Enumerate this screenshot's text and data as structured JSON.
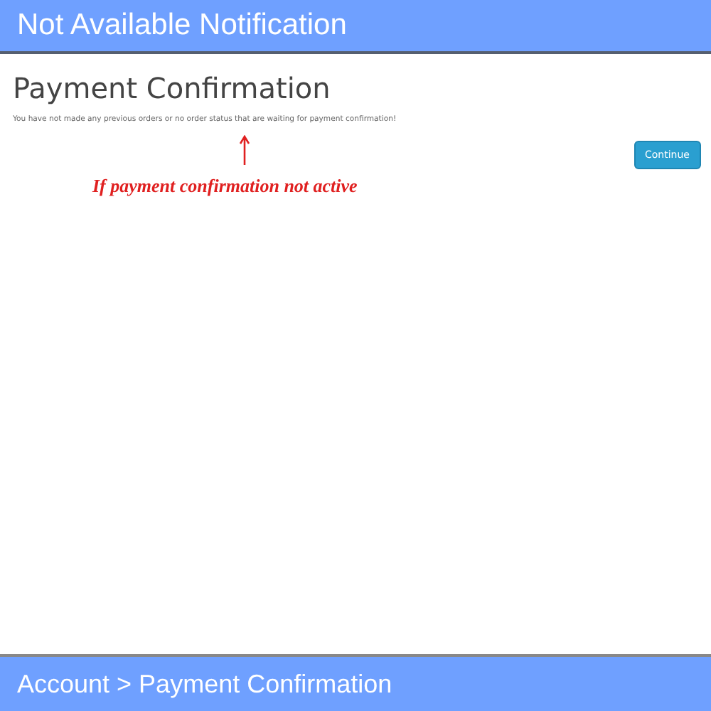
{
  "banner": {
    "title": "Not Available Notification"
  },
  "page": {
    "heading": "Payment Confirmation",
    "message": "You have not made any previous orders or no order status that are waiting for payment confirmation!",
    "button": "Continue"
  },
  "annotation": {
    "text": "If payment confirmation not active"
  },
  "footer": {
    "breadcrumb": "Account > Payment Confirmation"
  }
}
